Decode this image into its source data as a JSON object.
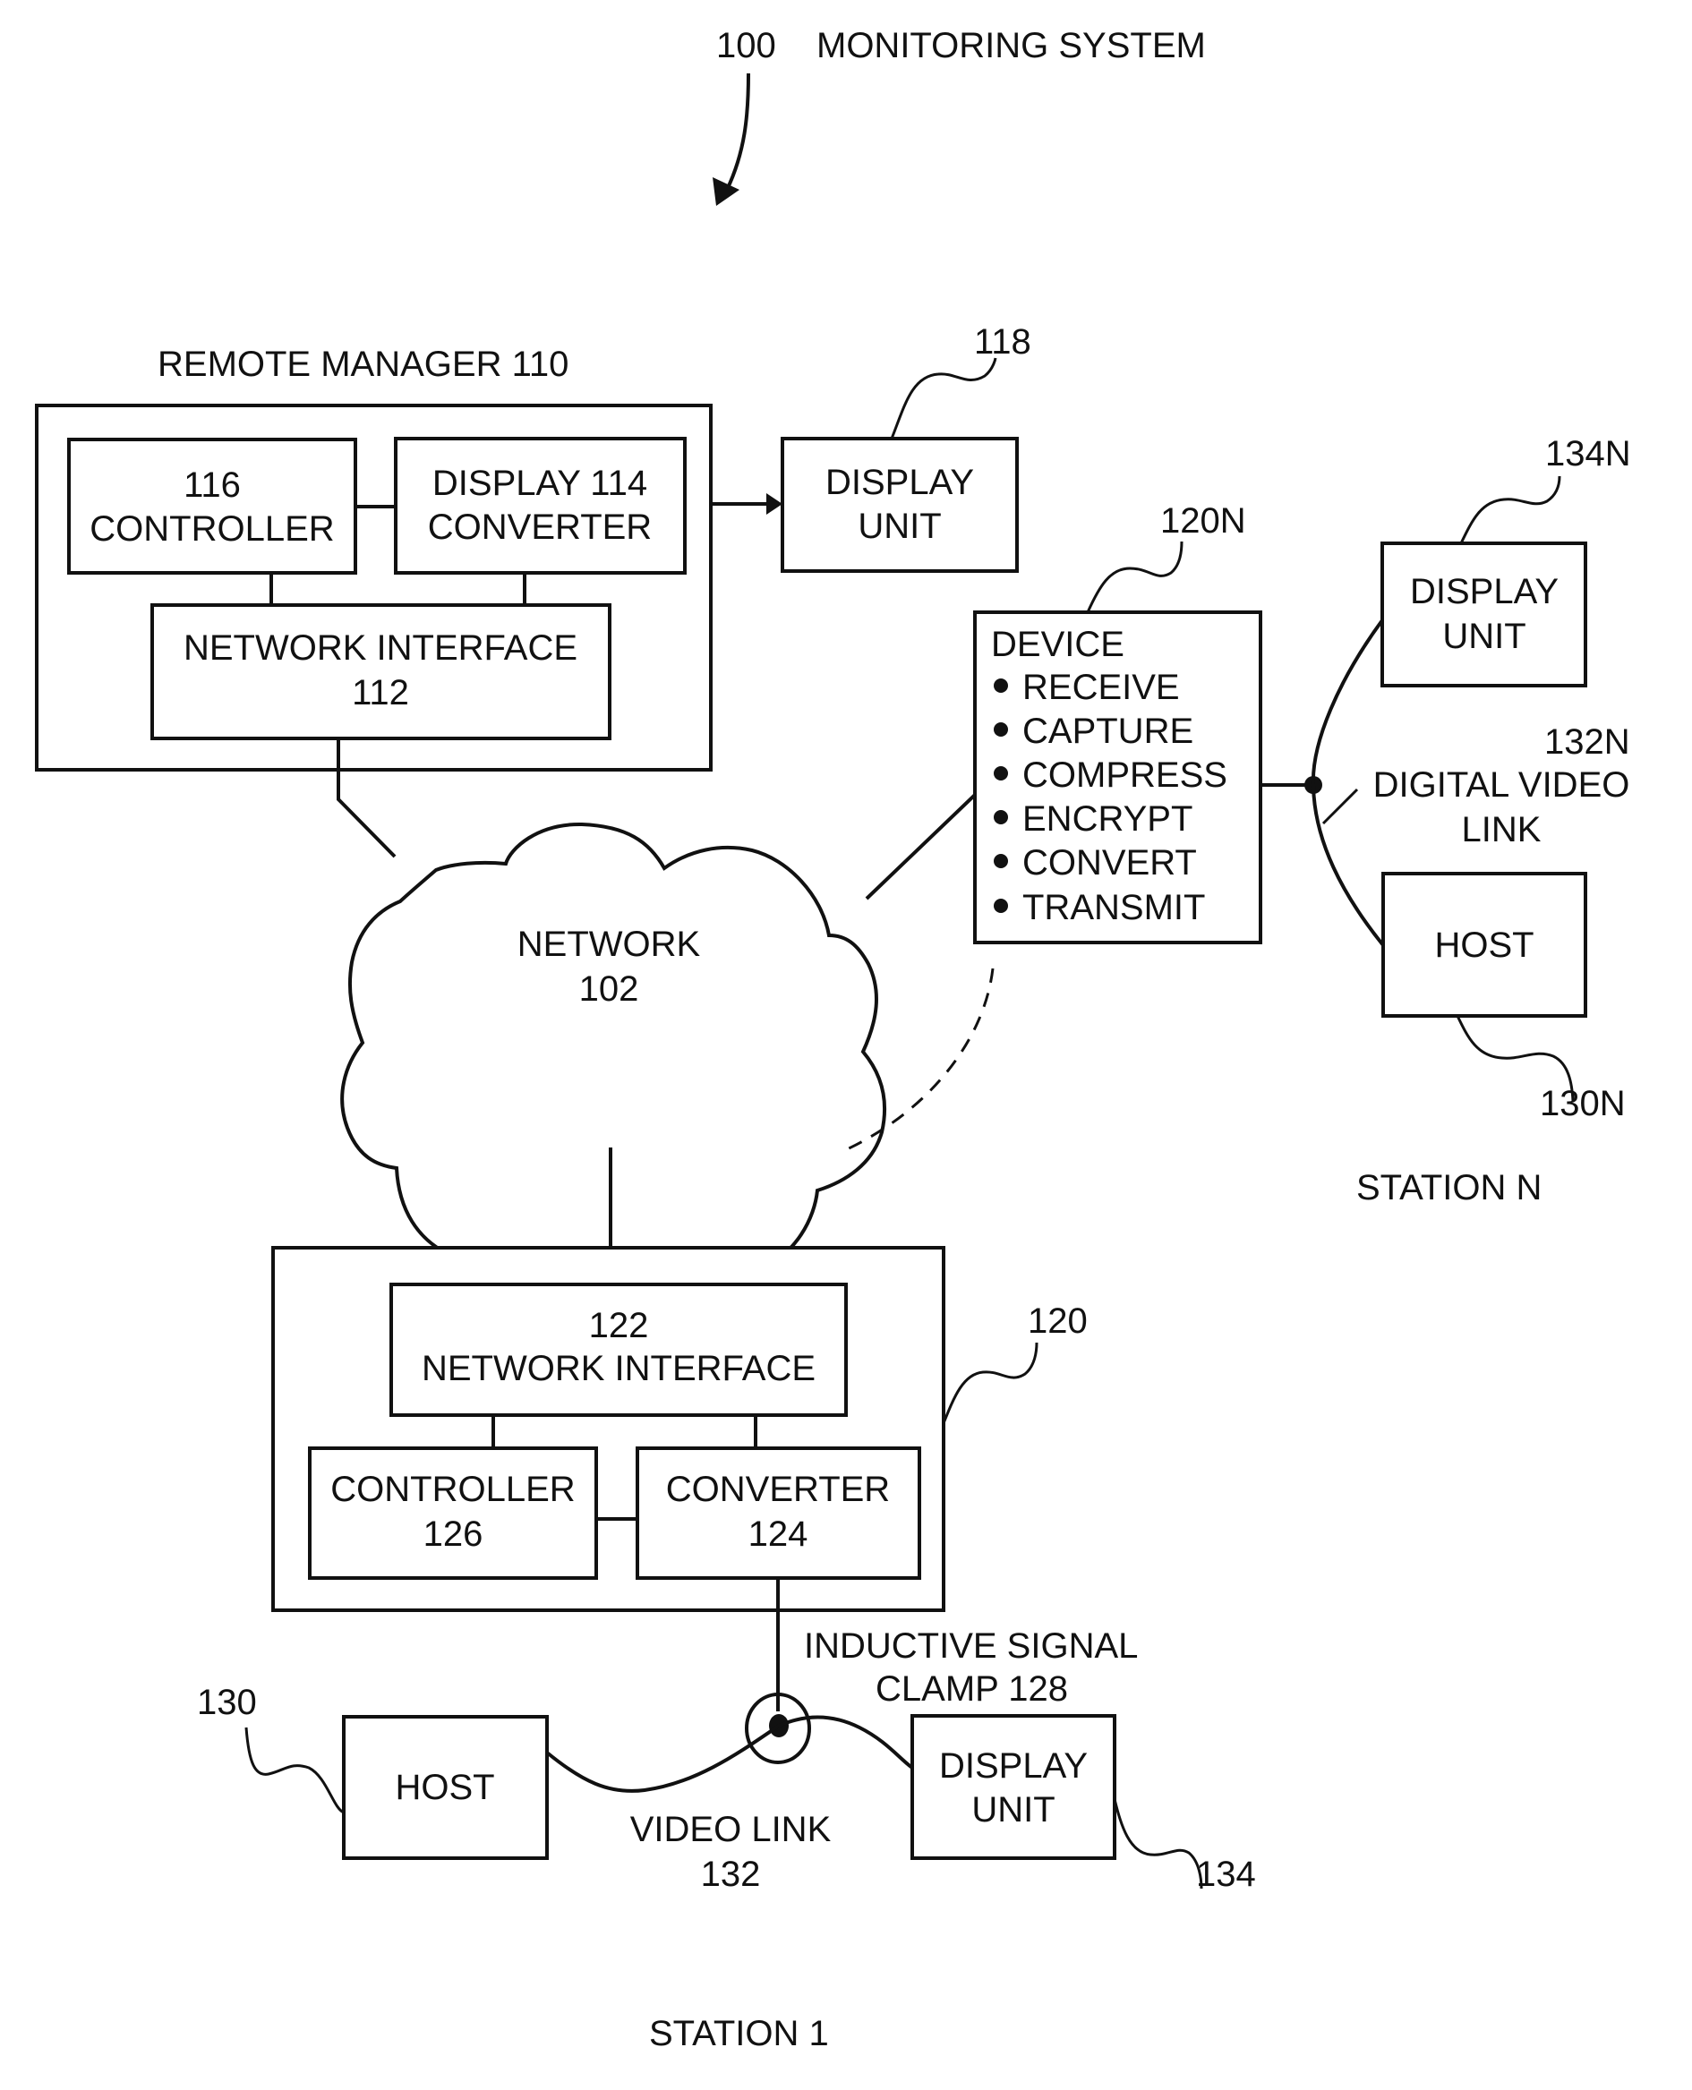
{
  "title": {
    "ref": "100",
    "name": "MONITORING SYSTEM"
  },
  "remote_manager": {
    "title": "REMOTE MANAGER 110",
    "controller": {
      "line1": "116",
      "line2": "CONTROLLER"
    },
    "converter": {
      "line1": "DISPLAY 114",
      "line2": "CONVERTER"
    },
    "network_interface": {
      "line1": "NETWORK INTERFACE",
      "line2": "112"
    }
  },
  "display_unit_118": {
    "ref": "118",
    "line1": "DISPLAY",
    "line2": "UNIT"
  },
  "network": {
    "line1": "NETWORK",
    "line2": "102"
  },
  "device_120n": {
    "ref": "120N",
    "title": "DEVICE",
    "functions": [
      "RECEIVE",
      "CAPTURE",
      "COMPRESS",
      "ENCRYPT",
      "CONVERT",
      "TRANSMIT"
    ]
  },
  "station_n": {
    "label": "STATION N",
    "display_unit": {
      "ref": "134N",
      "line1": "DISPLAY",
      "line2": "UNIT"
    },
    "link": {
      "ref": "132N",
      "line1": "DIGITAL VIDEO",
      "line2": "LINK"
    },
    "host": {
      "ref": "130N",
      "label": "HOST"
    }
  },
  "station_1": {
    "label": "STATION 1",
    "ref": "120",
    "network_interface": {
      "line1": "122",
      "line2": "NETWORK INTERFACE"
    },
    "controller": {
      "line1": "CONTROLLER",
      "line2": "126"
    },
    "converter": {
      "line1": "CONVERTER",
      "line2": "124"
    },
    "clamp": {
      "line1": "INDUCTIVE SIGNAL",
      "line2": "CLAMP 128"
    },
    "host": {
      "ref": "130",
      "label": "HOST"
    },
    "video_link": {
      "line1": "VIDEO LINK",
      "line2": "132"
    },
    "display_unit": {
      "ref": "134",
      "line1": "DISPLAY",
      "line2": "UNIT"
    }
  }
}
